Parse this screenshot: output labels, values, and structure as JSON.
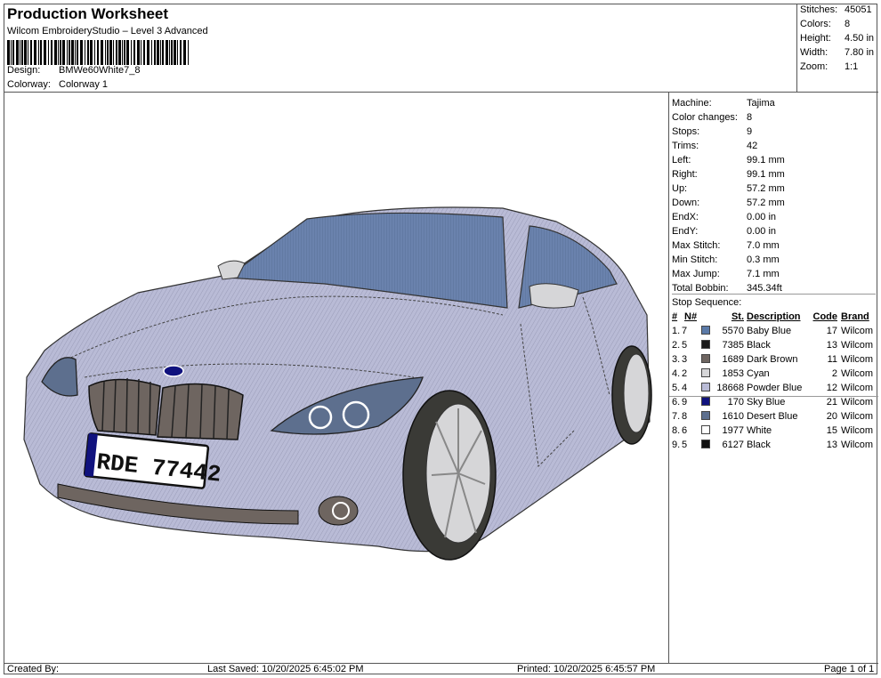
{
  "header": {
    "title": "Production Worksheet",
    "software": "Wilcom EmbroideryStudio – Level 3 Advanced",
    "design_label": "Design:",
    "design_value": "BMWe60White7_8",
    "colorway_label": "Colorway:",
    "colorway_value": "Colorway 1"
  },
  "summary": [
    {
      "label": "Stitches:",
      "value": "45051"
    },
    {
      "label": "Colors:",
      "value": "8"
    },
    {
      "label": "Height:",
      "value": "4.50 in"
    },
    {
      "label": "Width:",
      "value": "7.80 in"
    },
    {
      "label": "Zoom:",
      "value": "1:1"
    }
  ],
  "machine_info": [
    {
      "label": "Machine:",
      "value": "Tajima"
    },
    {
      "label": "Color changes:",
      "value": "8"
    },
    {
      "label": "Stops:",
      "value": "9"
    },
    {
      "label": "Trims:",
      "value": "42"
    },
    {
      "label": "Left:",
      "value": "99.1 mm"
    },
    {
      "label": "Right:",
      "value": "99.1 mm"
    },
    {
      "label": "Up:",
      "value": "57.2 mm"
    },
    {
      "label": "Down:",
      "value": "57.2 mm"
    },
    {
      "label": "EndX:",
      "value": "0.00 in"
    },
    {
      "label": "EndY:",
      "value": "0.00 in"
    },
    {
      "label": "Max Stitch:",
      "value": "7.0 mm"
    },
    {
      "label": "Min Stitch:",
      "value": "0.3 mm"
    },
    {
      "label": "Max Jump:",
      "value": "7.1 mm"
    },
    {
      "label": "Total Bobbin:",
      "value": "345.34ft"
    }
  ],
  "stop_sequence": {
    "title": "Stop Sequence:",
    "headers": {
      "num": "#",
      "n": "N#",
      "st": "St.",
      "description": "Description",
      "code": "Code",
      "brand": "Brand"
    },
    "rows": [
      {
        "num": "1.",
        "n": "7",
        "color": "#5b7aa8",
        "st": "5570",
        "description": "Baby Blue",
        "code": "17",
        "brand": "Wilcom"
      },
      {
        "num": "2.",
        "n": "5",
        "color": "#1a1a1a",
        "st": "7385",
        "description": "Black",
        "code": "13",
        "brand": "Wilcom"
      },
      {
        "num": "3.",
        "n": "3",
        "color": "#6e6560",
        "st": "1689",
        "description": "Dark Brown",
        "code": "11",
        "brand": "Wilcom"
      },
      {
        "num": "4.",
        "n": "2",
        "color": "#d6d6d8",
        "st": "1853",
        "description": "Cyan",
        "code": "2",
        "brand": "Wilcom"
      },
      {
        "num": "5.",
        "n": "4",
        "color": "#b9bbd6",
        "st": "18668",
        "description": "Powder Blue",
        "code": "12",
        "brand": "Wilcom"
      },
      {
        "num": "6.",
        "n": "9",
        "color": "#10127e",
        "st": "170",
        "description": "Sky Blue",
        "code": "21",
        "brand": "Wilcom"
      },
      {
        "num": "7.",
        "n": "8",
        "color": "#5d6f8e",
        "st": "1610",
        "description": "Desert Blue",
        "code": "20",
        "brand": "Wilcom"
      },
      {
        "num": "8.",
        "n": "6",
        "color": "#ffffff",
        "st": "1977",
        "description": "White",
        "code": "15",
        "brand": "Wilcom"
      },
      {
        "num": "9.",
        "n": "5",
        "color": "#111111",
        "st": "6127",
        "description": "Black",
        "code": "13",
        "brand": "Wilcom"
      }
    ]
  },
  "design_preview": {
    "plate_text": "RDE 77442"
  },
  "footer": {
    "created_by": "Created By:",
    "last_saved": "Last Saved: 10/20/2025 6:45:02 PM",
    "printed": "Printed: 10/20/2025 6:45:57 PM",
    "page": "Page 1 of 1"
  }
}
